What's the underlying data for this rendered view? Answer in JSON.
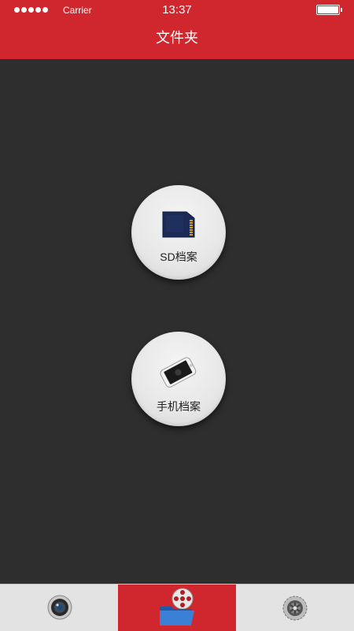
{
  "status_bar": {
    "carrier": "Carrier",
    "time": "13:37"
  },
  "header": {
    "title": "文件夹"
  },
  "main": {
    "buttons": [
      {
        "label": "SD档案",
        "icon": "sd-card-icon"
      },
      {
        "label": "手机档案",
        "icon": "smartphone-icon"
      }
    ]
  },
  "tabbar": {
    "tabs": [
      {
        "name": "camera",
        "icon": "camera-lens-icon",
        "selected": false
      },
      {
        "name": "files",
        "icon": "folder-film-icon",
        "selected": true
      },
      {
        "name": "settings",
        "icon": "gear-icon",
        "selected": false
      }
    ]
  },
  "colors": {
    "accent": "#d0262e",
    "background": "#2e2e2e",
    "tabbar": "#e3e3e3"
  }
}
